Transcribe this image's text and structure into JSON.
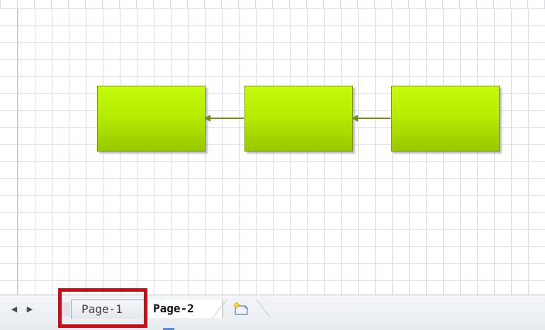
{
  "canvas": {
    "grid_color": "#d6dbe2",
    "background": "#ffffff"
  },
  "diagram": {
    "shape_fill": "#b7ec03",
    "shape_border": "#6f9a00",
    "connector_color": "#6e8f1a"
  },
  "tabbar": {
    "prev_icon": "◀",
    "next_icon": "▶",
    "tabs": [
      {
        "label": "Page-1",
        "active": false
      },
      {
        "label": "Page-2",
        "active": true
      }
    ],
    "insert_icon": "insert-page-icon"
  },
  "highlight": {
    "color": "#c80f17",
    "target": "Page-1"
  }
}
